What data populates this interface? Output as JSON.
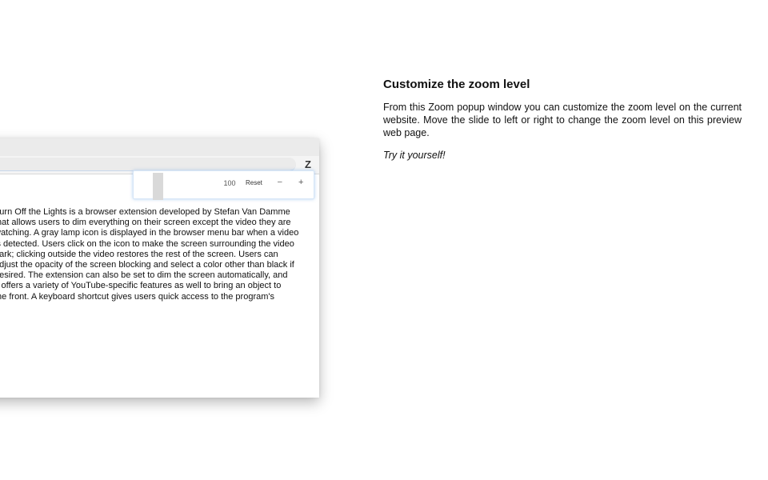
{
  "browser": {
    "extension_icon": "Z",
    "zoom_popup": {
      "value": "100",
      "reset_label": "Reset",
      "minus_label": "–",
      "plus_label": "+"
    },
    "page_lines": [
      "Turn Off the Lights is a browser extension developed by Stefan Van Damme",
      "that allows users to dim everything on their screen except the video they are",
      "watching. A gray lamp icon is displayed in the browser menu bar when a video",
      "is detected. Users click on the icon to make the screen surrounding the video",
      "dark; clicking outside the video restores the rest of the screen. Users can",
      "adjust the opacity of the screen blocking and select a color other than black if",
      "desired. The extension can also be set to dim the screen automatically, and",
      "it offers a variety of YouTube-specific features as well to bring an object to",
      "the front. A keyboard shortcut gives users quick access to the program's"
    ]
  },
  "info": {
    "title": "Customize the zoom level",
    "description": "From this Zoom popup window you can customize the zoom level on the current website. Move the slide to left or right to change the zoom level on this preview web page.",
    "cta": "Try it yourself!"
  }
}
